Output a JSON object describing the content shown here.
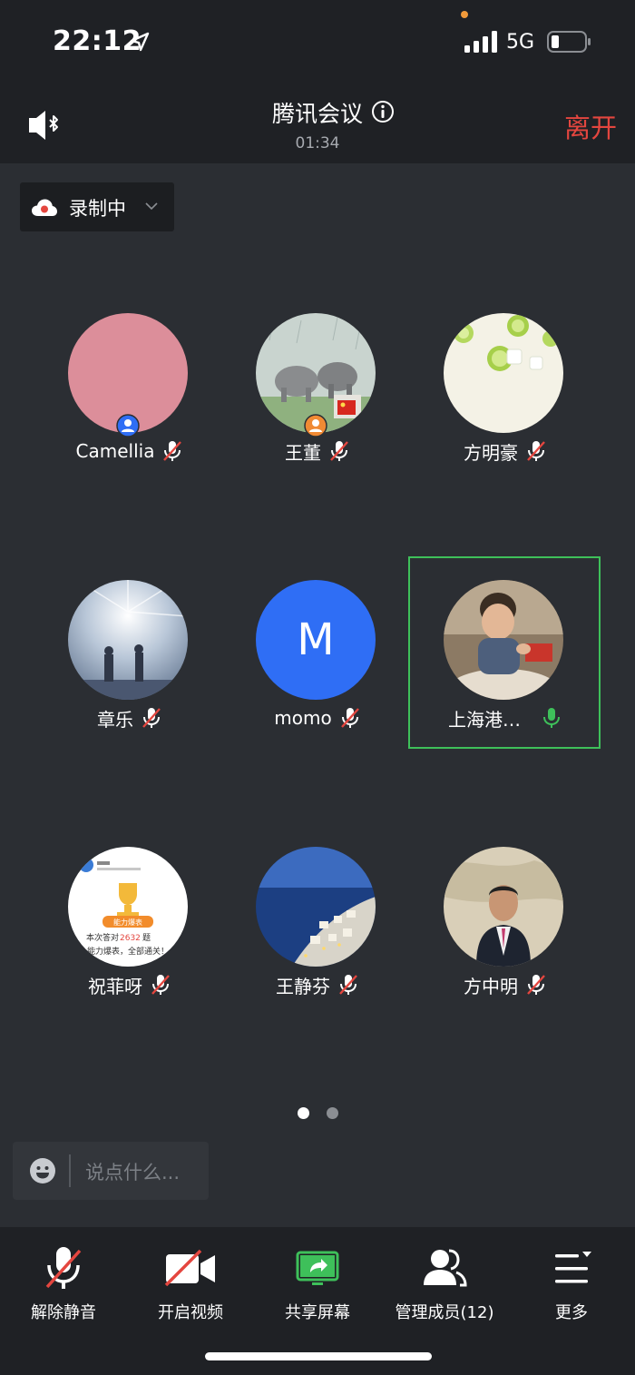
{
  "status_bar": {
    "time": "22:12",
    "network": "5G"
  },
  "header": {
    "title": "腾讯会议",
    "duration": "01:34",
    "leave_label": "离开"
  },
  "recording": {
    "label": "录制中"
  },
  "participants": [
    {
      "name": "Camellia",
      "mic": "muted",
      "badge": "host"
    },
    {
      "name": "王董",
      "mic": "muted",
      "badge": "cohost"
    },
    {
      "name": "方明豪",
      "mic": "muted"
    },
    {
      "name": "章乐",
      "mic": "muted"
    },
    {
      "name": "momo",
      "mic": "muted",
      "initial": "M"
    },
    {
      "name": "上海港…",
      "mic": "active",
      "speaking": true
    },
    {
      "name": "祝菲呀",
      "mic": "muted",
      "avatar_text": [
        "本次答对",
        "2632",
        "题",
        "能力爆表，全部通关！",
        "能力爆表"
      ]
    },
    {
      "name": "王静芬",
      "mic": "muted"
    },
    {
      "name": "方中明",
      "mic": "muted"
    }
  ],
  "pagination": {
    "current": 1,
    "total": 2
  },
  "chat": {
    "placeholder": "说点什么..."
  },
  "toolbar": {
    "unmute": "解除静音",
    "start_video": "开启视频",
    "share_screen": "共享屏幕",
    "manage_members": "管理成员(12)",
    "more": "更多"
  },
  "colors": {
    "background": "#2b2e33",
    "leave": "#e4463f",
    "muted_slash": "#e4463f",
    "speaking": "#3ec05a",
    "share": "#3ec05a",
    "momo_avatar": "#2f6ef5"
  }
}
